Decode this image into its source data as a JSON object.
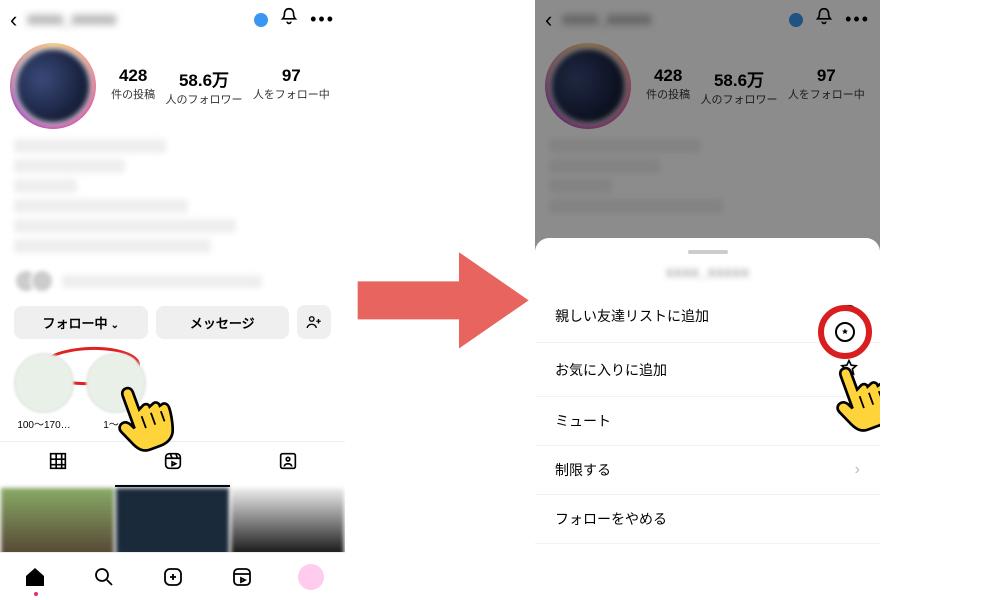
{
  "left": {
    "username_blur": "xxxx_xxxxx",
    "verified": true,
    "stats": {
      "posts": {
        "n": "428",
        "l": "件の投稿"
      },
      "followers": {
        "n": "58.6万",
        "l": "人のフォロワー"
      },
      "following": {
        "n": "97",
        "l": "人をフォロー中"
      }
    },
    "buttons": {
      "following": "フォロー中",
      "message": "メッセージ"
    },
    "highlights": [
      {
        "label": "100～170…"
      },
      {
        "label": "1～…"
      }
    ]
  },
  "right": {
    "sheet": {
      "title_blur": "xxxx_xxxxx",
      "rows": {
        "close_friends": "親しい友達リストに追加",
        "favorites": "お気に入りに追加",
        "mute": "ミュート",
        "restrict": "制限する",
        "unfollow": "フォローをやめる"
      }
    }
  }
}
